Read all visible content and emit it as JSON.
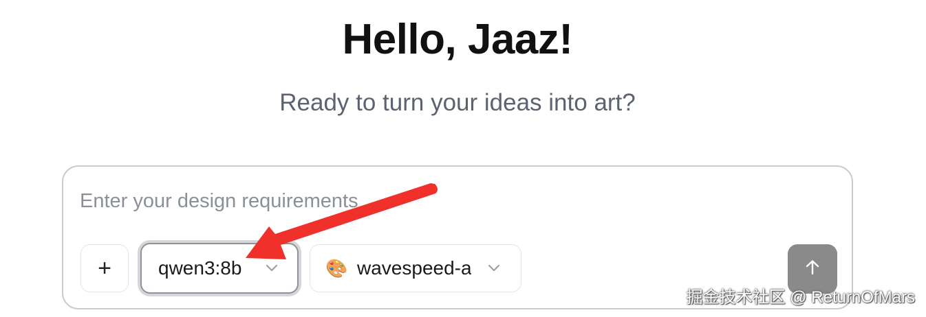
{
  "header": {
    "greeting": "Hello, Jaaz!",
    "subtitle": "Ready to turn your ideas into art?"
  },
  "composer": {
    "placeholder": "Enter your design requirements",
    "add_label": "+",
    "model_select": {
      "value": "qwen3:8b",
      "icon": "chevron-down-icon"
    },
    "tool_select": {
      "emoji": "🎨",
      "value": "wavespeed-ai",
      "icon": "chevron-down-icon"
    },
    "send_icon": "arrow-up-icon"
  },
  "annotation": {
    "color": "#f0302a"
  },
  "watermark": "掘金技术社区 @ ReturnOfMars"
}
